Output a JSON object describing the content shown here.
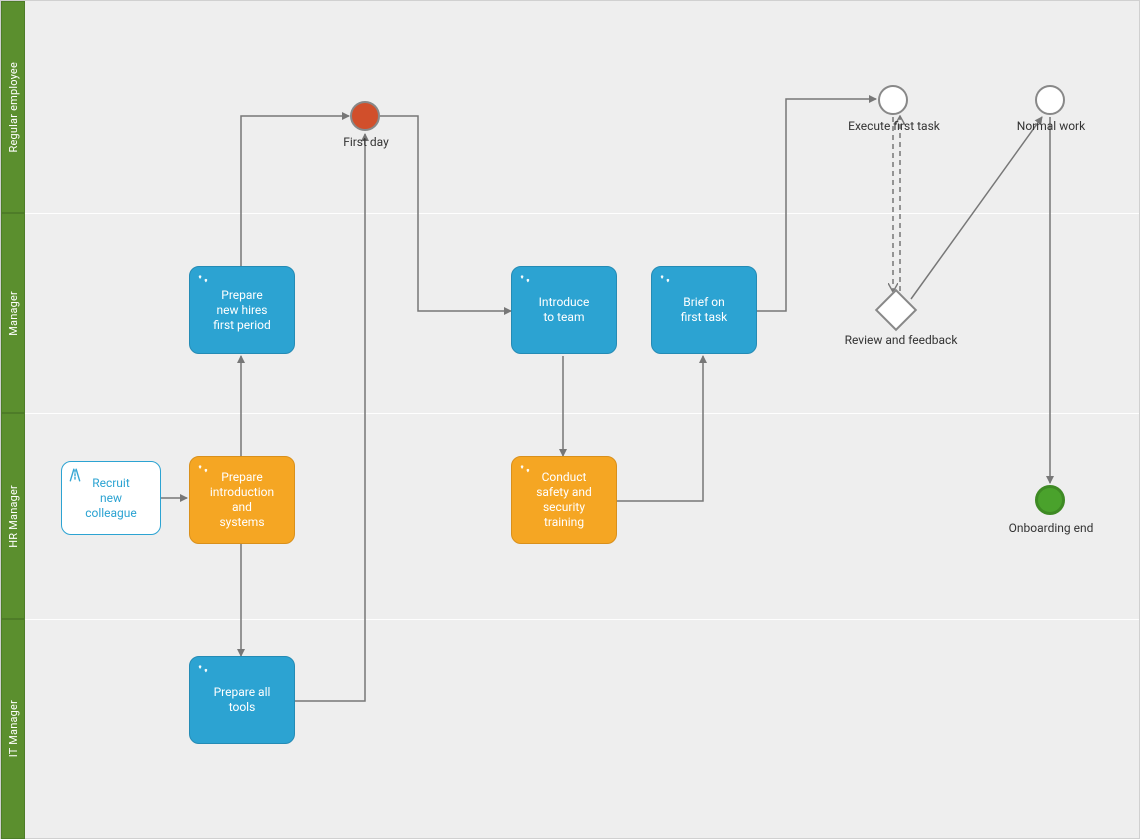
{
  "lanes": {
    "regular_employee": "Regular employee",
    "manager": "Manager",
    "hr_manager": "HR Manager",
    "it_manager": "IT Manager"
  },
  "nodes": {
    "recruit": "Recruit\nnew\ncolleague",
    "prepare_intro": "Prepare\nintroduction\nand\nsystems",
    "prepare_period": "Prepare\nnew hires\nfirst period",
    "prepare_tools": "Prepare all\ntools",
    "introduce": "Introduce\nto team",
    "conduct_training": "Conduct\nsafety and\nsecurity\ntraining",
    "brief": "Brief on\nfirst task"
  },
  "events": {
    "first_day": "First day",
    "execute_first_task": "Execute first task",
    "normal_work": "Normal work",
    "review_feedback": "Review and feedback",
    "onboarding_end": "Onboarding end"
  }
}
